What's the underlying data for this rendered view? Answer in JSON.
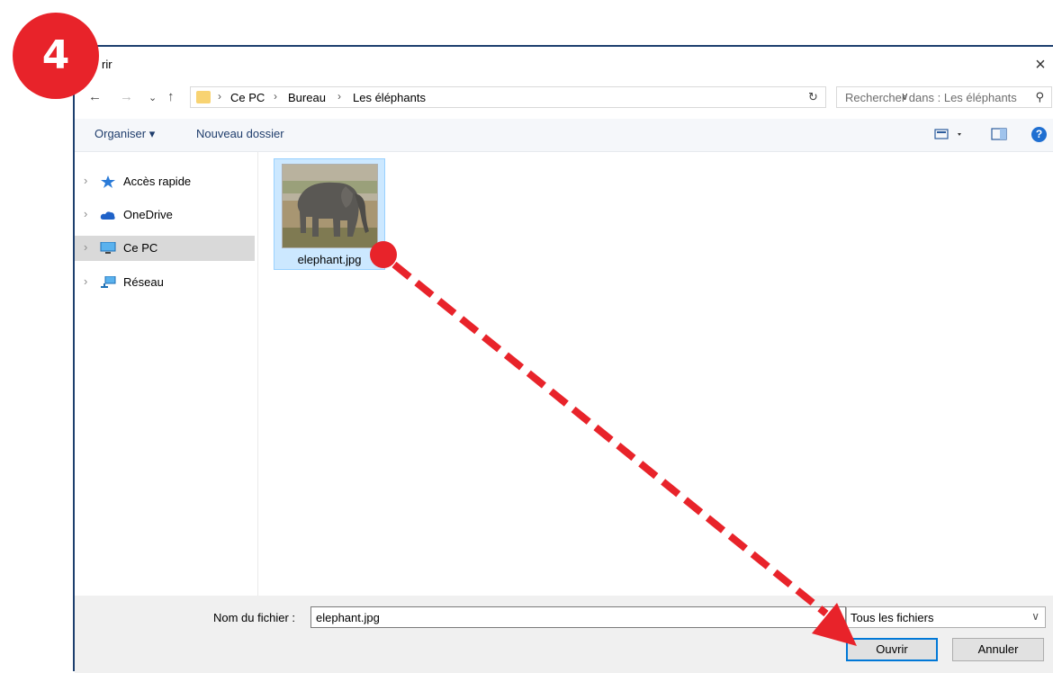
{
  "dialog": {
    "title": "rir",
    "close_glyph": "×"
  },
  "address": {
    "crumbs": [
      "Ce PC",
      "Bureau",
      "Les éléphants"
    ],
    "search_placeholder": "Rechercher dans : Les éléphants"
  },
  "toolbar": {
    "organize_label": "Organiser ▾",
    "new_folder_label": "Nouveau dossier",
    "help_label": "?"
  },
  "navpane": {
    "items": [
      {
        "label": "Accès rapide",
        "icon": "star-icon"
      },
      {
        "label": "OneDrive",
        "icon": "cloud-icon"
      },
      {
        "label": "Ce PC",
        "icon": "computer-icon",
        "selected": true
      },
      {
        "label": "Réseau",
        "icon": "network-icon"
      }
    ]
  },
  "files": [
    {
      "name": "elephant.jpg",
      "selected": true
    }
  ],
  "footer": {
    "filename_label": "Nom du fichier :",
    "filename_value": "elephant.jpg",
    "filetype_value": "Tous les fichiers",
    "open_label": "Ouvrir",
    "cancel_label": "Annuler"
  },
  "annotation": {
    "step_number": "4",
    "color": "#e8232a"
  }
}
